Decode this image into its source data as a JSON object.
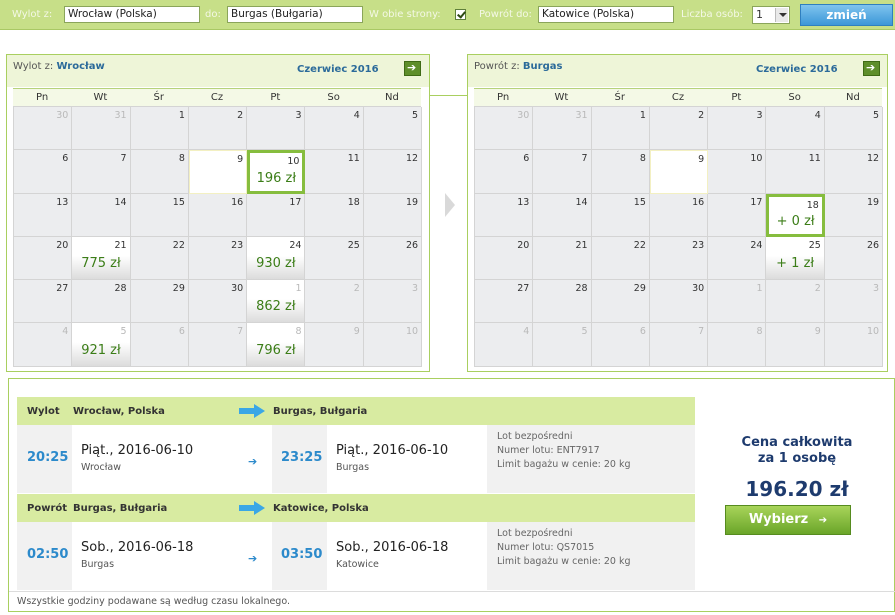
{
  "search": {
    "from_label": "Wylot z:",
    "from_value": "Wrocław (Polska)",
    "to_label": "do:",
    "to_value": "Burgas (Bułgaria)",
    "roundtrip_label": "W obie strony:",
    "roundtrip_checked": true,
    "return_label": "Powrót do:",
    "return_value": "Katowice (Polska)",
    "persons_label": "Liczba osób:",
    "persons_value": "1",
    "change_button": "zmień"
  },
  "outbound_calendar": {
    "where_label": "Wylot z:",
    "city": "Wrocław",
    "month": "Czerwiec 2016",
    "weekdays": [
      "Pn",
      "Wt",
      "Śr",
      "Cz",
      "Pt",
      "So",
      "Nd"
    ],
    "days": [
      {
        "n": "30",
        "other": true
      },
      {
        "n": "31",
        "other": true
      },
      {
        "n": "1"
      },
      {
        "n": "2"
      },
      {
        "n": "3"
      },
      {
        "n": "4"
      },
      {
        "n": "5"
      },
      {
        "n": "6"
      },
      {
        "n": "7"
      },
      {
        "n": "8"
      },
      {
        "n": "9",
        "today": true
      },
      {
        "n": "10",
        "price": "196 zł",
        "selected": true
      },
      {
        "n": "11"
      },
      {
        "n": "12"
      },
      {
        "n": "13"
      },
      {
        "n": "14"
      },
      {
        "n": "15"
      },
      {
        "n": "16"
      },
      {
        "n": "17"
      },
      {
        "n": "18"
      },
      {
        "n": "19"
      },
      {
        "n": "20"
      },
      {
        "n": "21",
        "price": "775 zł"
      },
      {
        "n": "22"
      },
      {
        "n": "23"
      },
      {
        "n": "24",
        "price": "930 zł"
      },
      {
        "n": "25"
      },
      {
        "n": "26"
      },
      {
        "n": "27"
      },
      {
        "n": "28"
      },
      {
        "n": "29"
      },
      {
        "n": "30"
      },
      {
        "n": "1",
        "other": true,
        "price": "862 zł"
      },
      {
        "n": "2",
        "other": true
      },
      {
        "n": "3",
        "other": true
      },
      {
        "n": "4",
        "other": true
      },
      {
        "n": "5",
        "other": true,
        "price": "921 zł"
      },
      {
        "n": "6",
        "other": true
      },
      {
        "n": "7",
        "other": true
      },
      {
        "n": "8",
        "other": true,
        "price": "796 zł"
      },
      {
        "n": "9",
        "other": true
      },
      {
        "n": "10",
        "other": true
      }
    ]
  },
  "return_calendar": {
    "where_label": "Powrót z:",
    "city": "Burgas",
    "month": "Czerwiec 2016",
    "weekdays": [
      "Pn",
      "Wt",
      "Śr",
      "Cz",
      "Pt",
      "So",
      "Nd"
    ],
    "days": [
      {
        "n": "30",
        "other": true
      },
      {
        "n": "31",
        "other": true
      },
      {
        "n": "1"
      },
      {
        "n": "2"
      },
      {
        "n": "3"
      },
      {
        "n": "4"
      },
      {
        "n": "5"
      },
      {
        "n": "6"
      },
      {
        "n": "7"
      },
      {
        "n": "8"
      },
      {
        "n": "9",
        "today": true
      },
      {
        "n": "10"
      },
      {
        "n": "11"
      },
      {
        "n": "12"
      },
      {
        "n": "13"
      },
      {
        "n": "14"
      },
      {
        "n": "15"
      },
      {
        "n": "16"
      },
      {
        "n": "17"
      },
      {
        "n": "18",
        "price": "+ 0 zł",
        "selected": true
      },
      {
        "n": "19"
      },
      {
        "n": "20"
      },
      {
        "n": "21"
      },
      {
        "n": "22"
      },
      {
        "n": "23"
      },
      {
        "n": "24"
      },
      {
        "n": "25",
        "price": "+ 1 zł"
      },
      {
        "n": "26"
      },
      {
        "n": "27"
      },
      {
        "n": "28"
      },
      {
        "n": "29"
      },
      {
        "n": "30"
      },
      {
        "n": "1",
        "other": true
      },
      {
        "n": "2",
        "other": true
      },
      {
        "n": "3",
        "other": true
      },
      {
        "n": "4",
        "other": true
      },
      {
        "n": "5",
        "other": true
      },
      {
        "n": "6",
        "other": true
      },
      {
        "n": "7",
        "other": true
      },
      {
        "n": "8",
        "other": true
      },
      {
        "n": "9",
        "other": true
      },
      {
        "n": "10",
        "other": true
      }
    ]
  },
  "outbound": {
    "label": "Wylot",
    "from": "Wrocław, Polska",
    "to": "Burgas, Bułgaria",
    "dep_time": "20:25",
    "dep_date": "Piąt., 2016-06-10",
    "dep_city": "Wrocław",
    "arr_time": "23:25",
    "arr_date": "Piąt., 2016-06-10",
    "arr_city": "Burgas",
    "info_type": "Lot bezpośredni",
    "info_flight": "Numer lotu: ENT7917",
    "info_baggage": "Limit bagażu w cenie: 20 kg"
  },
  "return": {
    "label": "Powrót",
    "from": "Burgas, Bułgaria",
    "to": "Katowice, Polska",
    "dep_time": "02:50",
    "dep_date": "Sob., 2016-06-18",
    "dep_city": "Burgas",
    "arr_time": "03:50",
    "arr_date": "Sob., 2016-06-18",
    "arr_city": "Katowice",
    "info_type": "Lot bezpośredni",
    "info_flight": "Numer lotu: QS7015",
    "info_baggage": "Limit bagażu w cenie: 20 kg"
  },
  "price": {
    "label_line1": "Cena całkowita",
    "label_line2": "za 1 osobę",
    "value": "196.20 zł",
    "choose_button": "Wybierz"
  },
  "footer_note": "Wszystkie godziny podawane są według czasu lokalnego.",
  "colors": {
    "accent_green": "#86bd3e",
    "search_bar": "#c7df88",
    "time_blue": "#2c8acb",
    "price_navy": "#1e3b6e"
  }
}
